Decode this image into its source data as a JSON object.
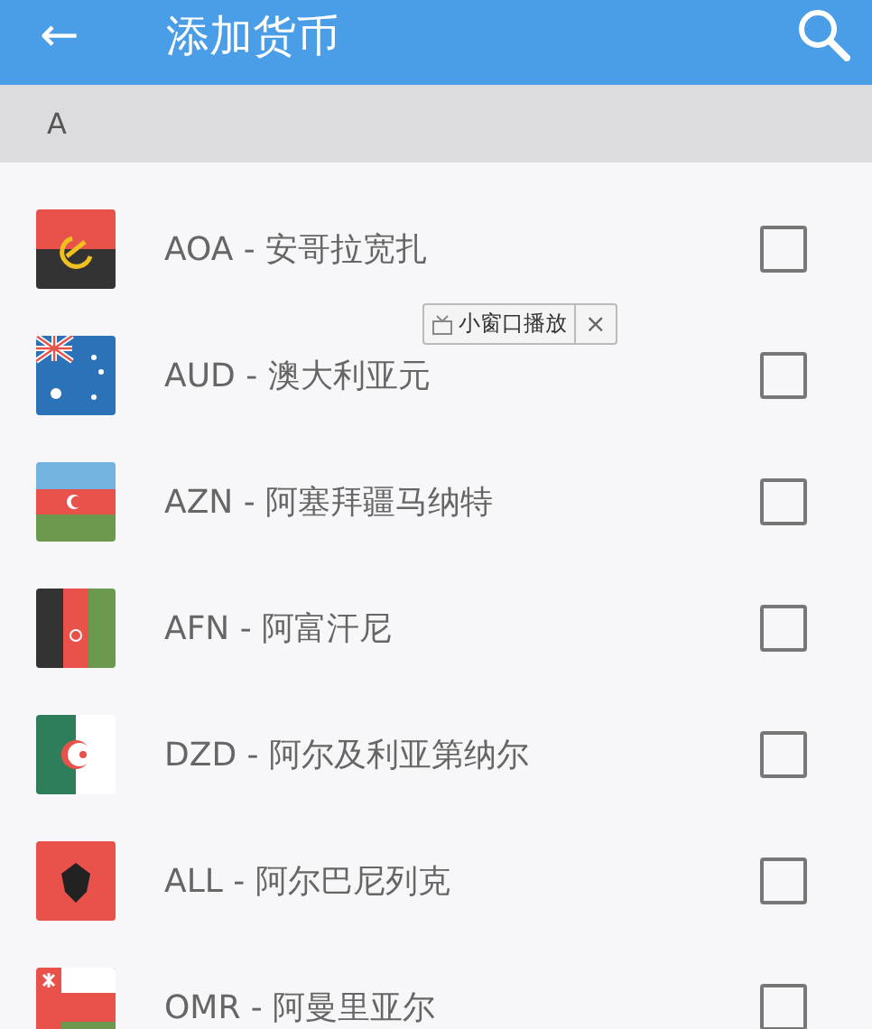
{
  "app_bar": {
    "back": "←",
    "title": "添加货币"
  },
  "section": {
    "letter": "A"
  },
  "currencies": [
    {
      "label": "AOA - 安哥拉宽扎",
      "checked": false
    },
    {
      "label": "AUD - 澳大利亚元",
      "checked": false
    },
    {
      "label": "AZN - 阿塞拜疆马纳特",
      "checked": false
    },
    {
      "label": "AFN - 阿富汗尼",
      "checked": false
    },
    {
      "label": "DZD - 阿尔及利亚第纳尔",
      "checked": false
    },
    {
      "label": "ALL - 阿尔巴尼列克",
      "checked": false
    },
    {
      "label": "OMR - 阿曼里亚尔",
      "checked": false
    }
  ],
  "popup": {
    "label": "小窗口播放",
    "close": "×"
  }
}
